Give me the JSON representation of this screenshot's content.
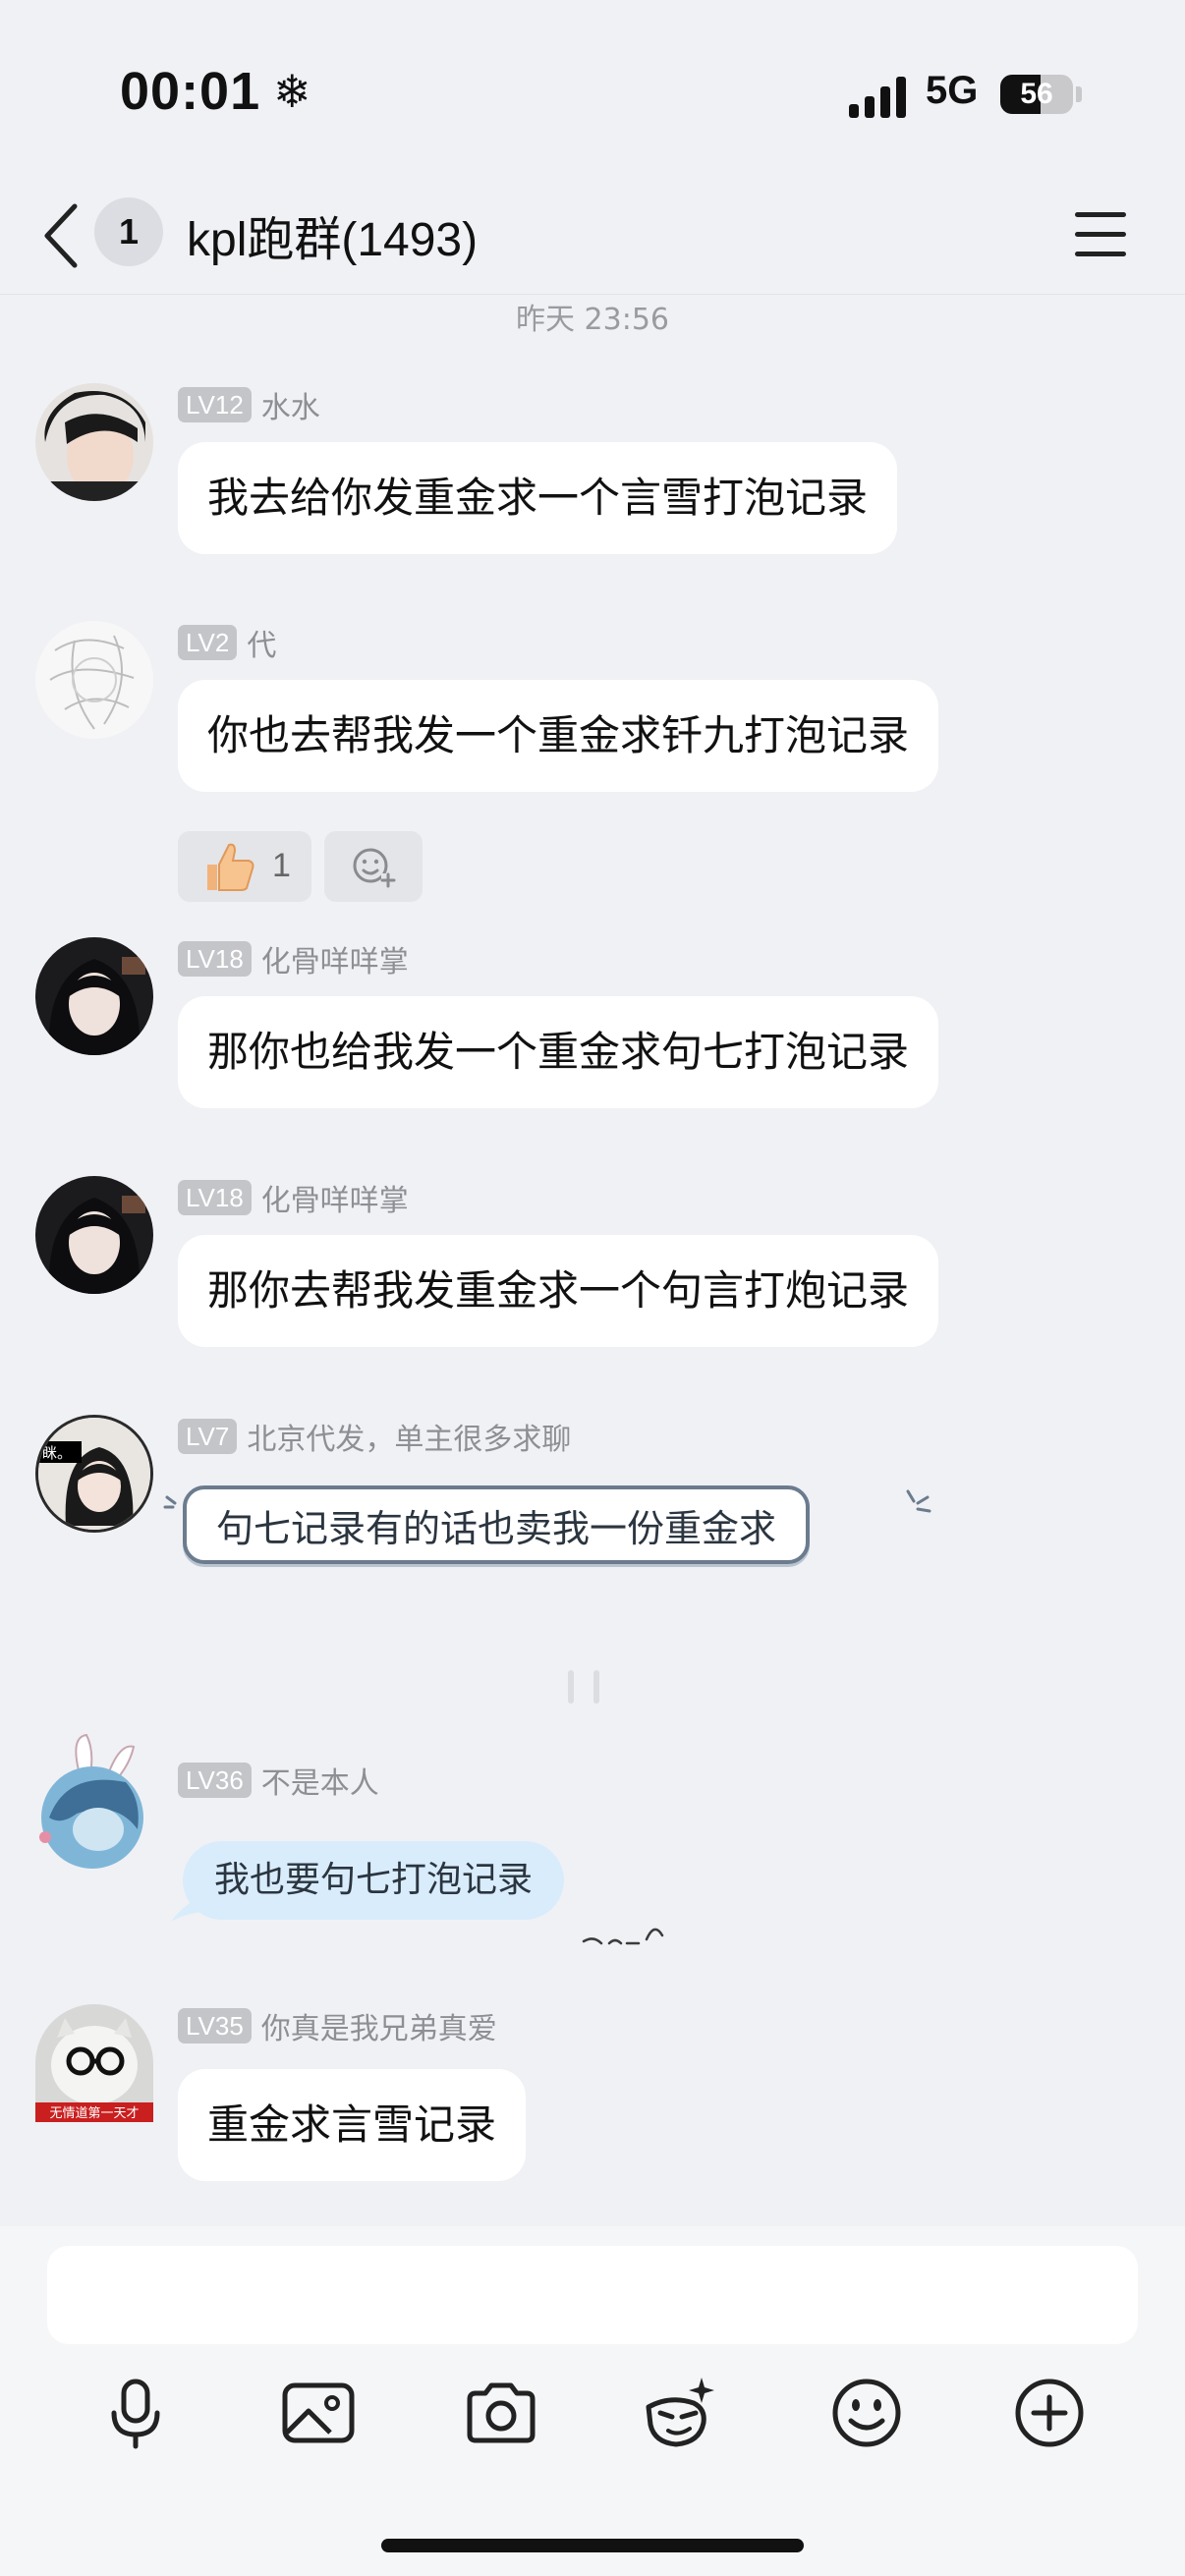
{
  "status_bar": {
    "time": "00:01",
    "status_icon": "snowflake-icon",
    "network": "5G",
    "battery_level": "56",
    "battery_fraction": 0.56
  },
  "nav": {
    "back_icon": "chevron-left-icon",
    "unread_count": "1",
    "title": "kpl跑群(1493)",
    "menu_icon": "hamburger-menu-icon"
  },
  "timestamp": "昨天 23:56",
  "messages": [
    {
      "level": "LV12",
      "nickname": "水水",
      "text": "我去给你发重金求一个言雪打泡记录"
    },
    {
      "level": "LV2",
      "nickname": "代",
      "text": "你也去帮我发一个重金求钎九打泡记录",
      "reactions": [
        {
          "icon": "thumbs-up-icon",
          "count": "1"
        },
        {
          "icon": "add-reaction-icon"
        }
      ]
    },
    {
      "level": "LV18",
      "nickname": "化骨咩咩掌",
      "text": "那你也给我发一个重金求句七打泡记录"
    },
    {
      "level": "LV18",
      "nickname": "化骨咩咩掌",
      "text": "那你去帮我发重金求一个句言打炮记录"
    },
    {
      "level": "LV7",
      "nickname": "北京代发，单主很多求聊",
      "text": "句七记录有的话也卖我一份重金求",
      "avatar_text": "眯。"
    },
    {
      "level": "LV36",
      "nickname": "不是本人",
      "text": "我也要句七打泡记录"
    },
    {
      "level": "LV35",
      "nickname": "你真是我兄弟真爱",
      "text": "重金求言雪记录",
      "avatar_banner": "无情道第一天才"
    }
  ],
  "toolbar": {
    "icons": [
      "microphone-icon",
      "image-icon",
      "camera-icon",
      "sticker-icon",
      "emoji-icon",
      "plus-icon"
    ]
  },
  "colors": {
    "background": "#f0f1f5",
    "bubble": "#ffffff",
    "level_badge": "#c4c5c9",
    "nickname": "#8e8f94"
  }
}
